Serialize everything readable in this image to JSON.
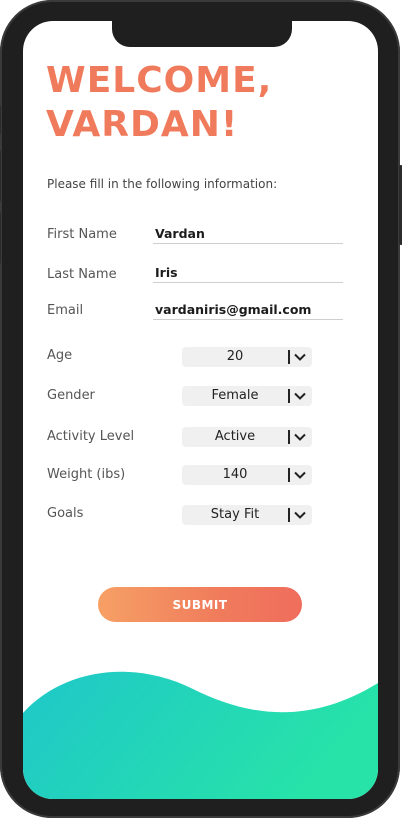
{
  "header": {
    "title_line1": "WELCOME,",
    "title_line2": "VARDAN!"
  },
  "form": {
    "instruction": "Please fill in the following information:",
    "first_name": {
      "label": "First Name",
      "value": "Vardan"
    },
    "last_name": {
      "label": "Last Name",
      "value": "Iris"
    },
    "email": {
      "label": "Email",
      "value": "vardaniris@gmail.com"
    },
    "age": {
      "label": "Age",
      "value": "20",
      "icon": "chevron-down-icon"
    },
    "gender": {
      "label": "Gender",
      "value": "Female",
      "icon": "chevron-down-icon"
    },
    "activity": {
      "label": "Activity Level",
      "value": "Active",
      "icon": "chevron-down-icon"
    },
    "weight": {
      "label": "Weight (ibs)",
      "value": "140",
      "icon": "chevron-down-icon"
    },
    "goals": {
      "label": "Goals",
      "value": "Stay Fit",
      "icon": "chevron-down-icon"
    },
    "submit_label": "SUBMIT"
  },
  "colors": {
    "accent": "#f07b5c",
    "wave_start": "#1fc7c9",
    "wave_end": "#27e3a8",
    "phone_frame": "#1f1f1f"
  }
}
